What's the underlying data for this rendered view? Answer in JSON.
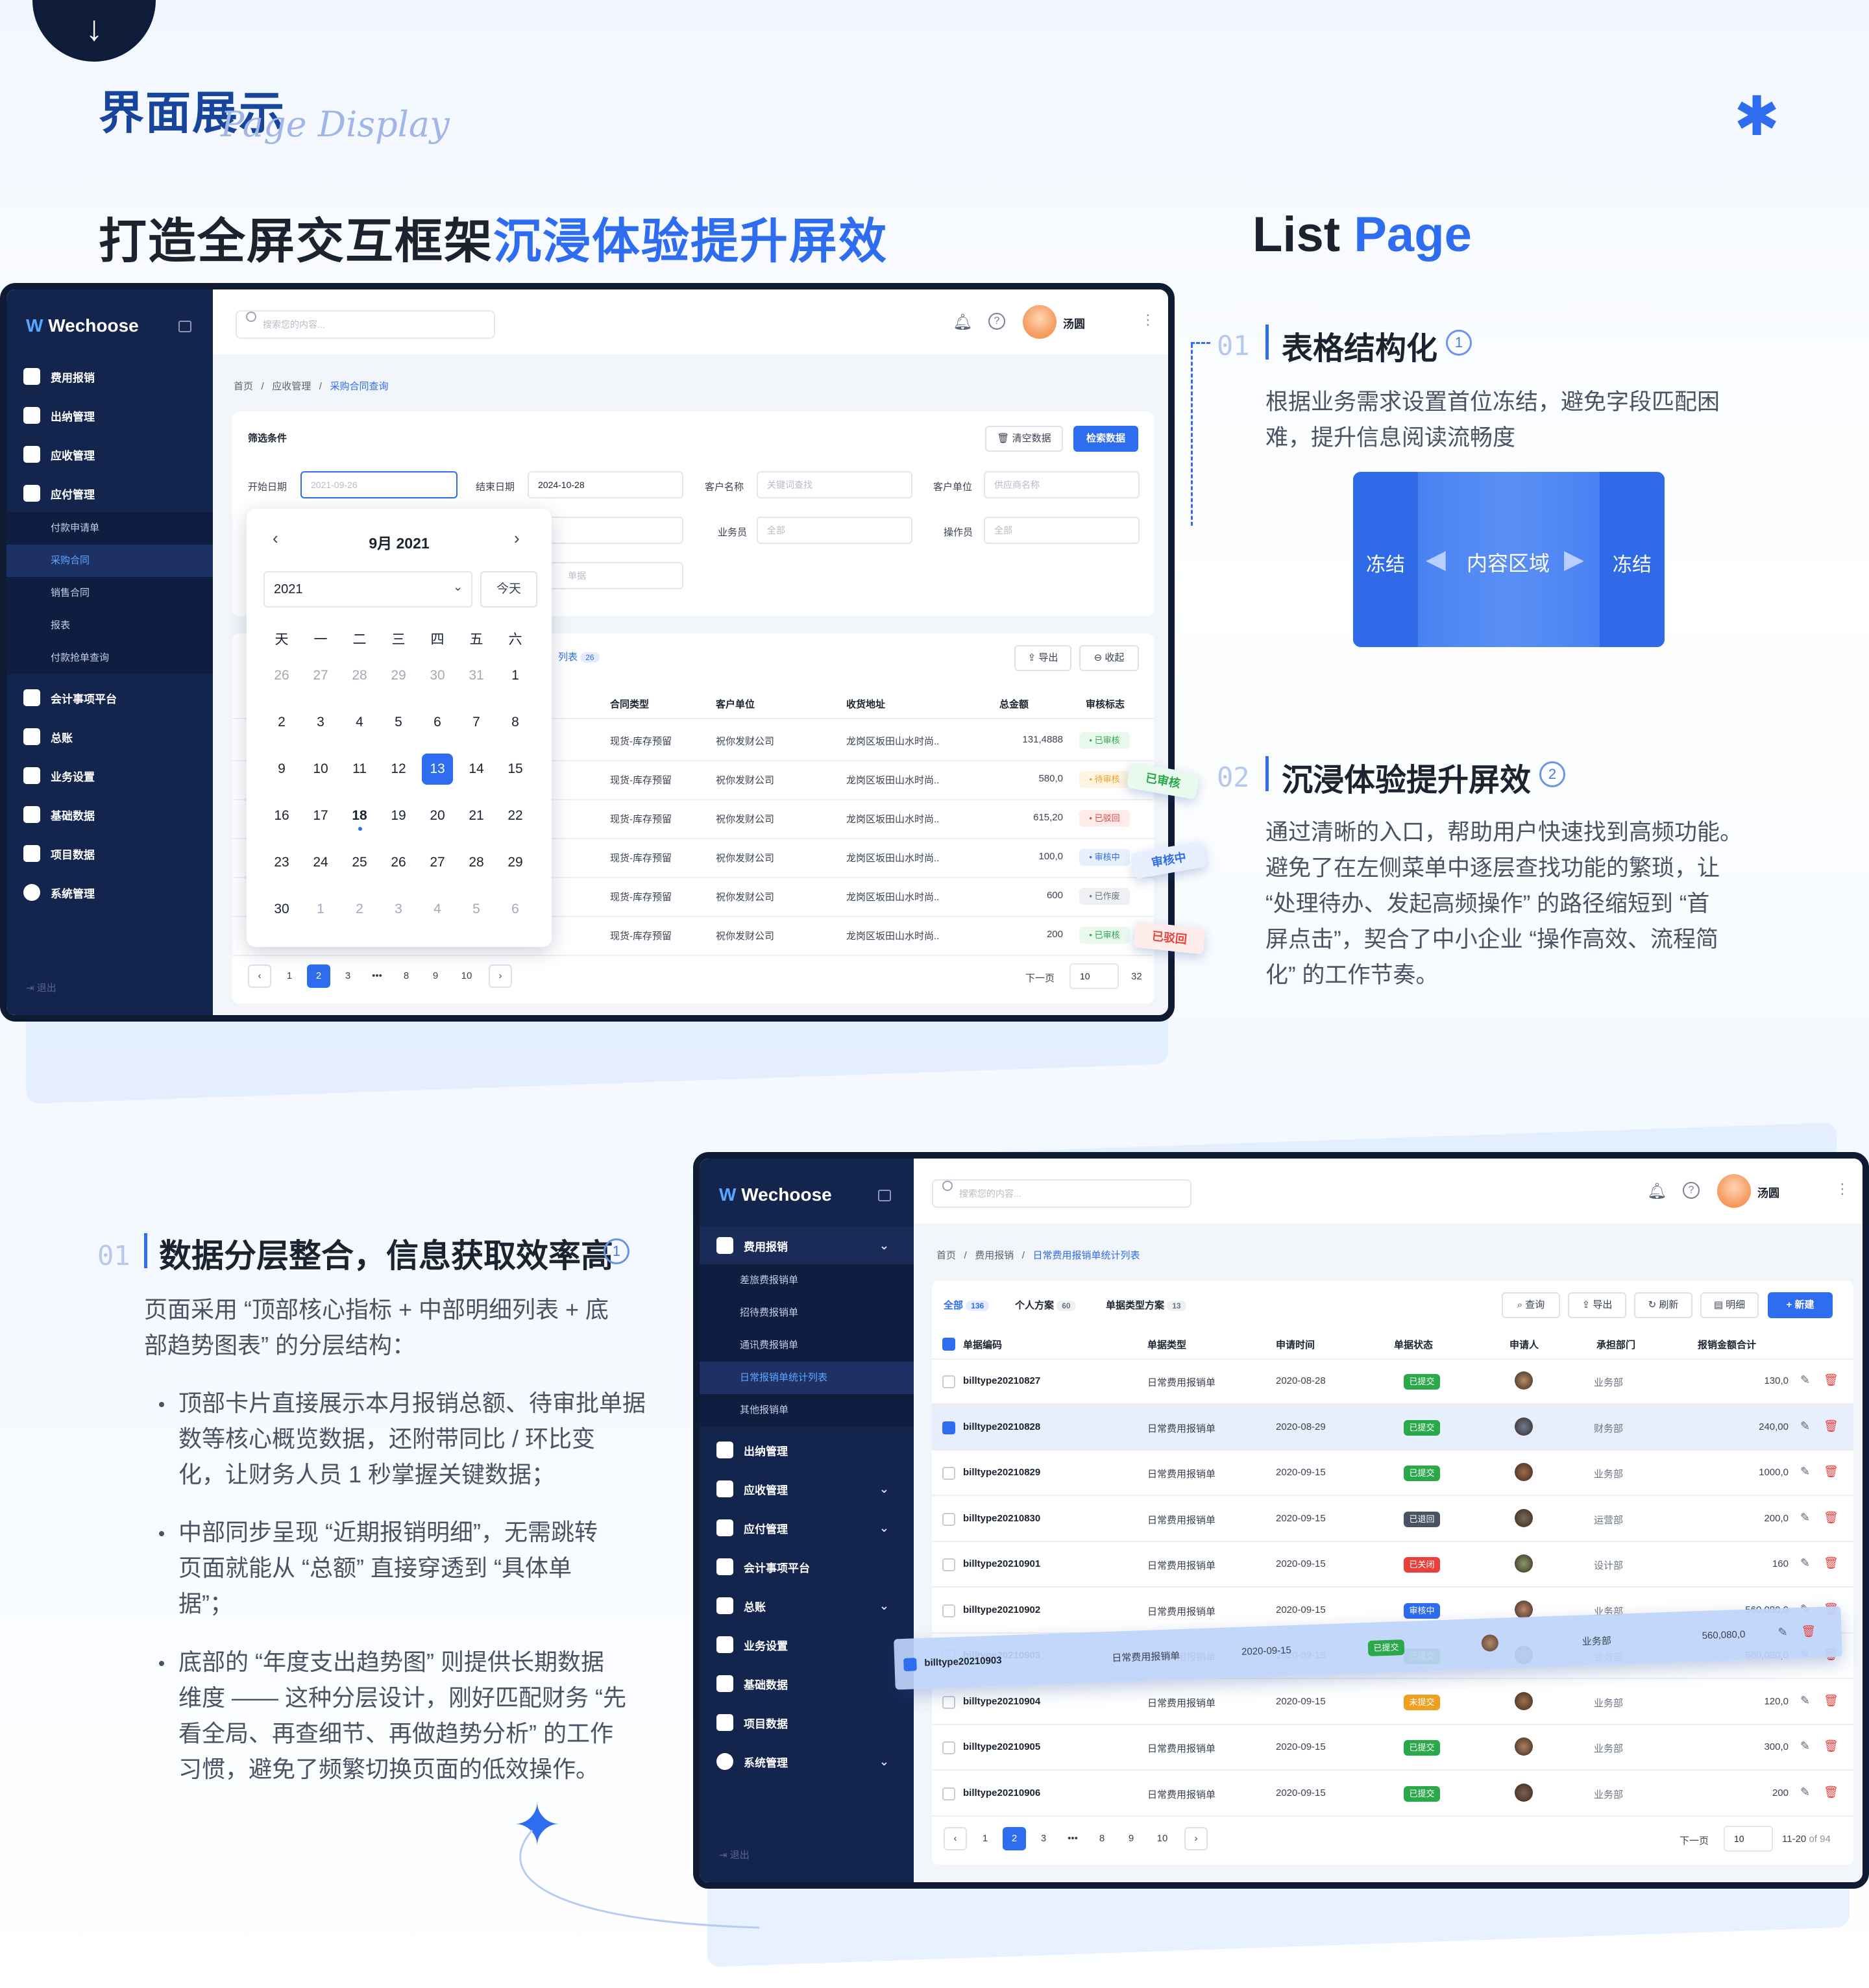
{
  "header": {
    "title": "界面展示",
    "script": "Page Display",
    "main_heading_a": "打造全屏交互框架",
    "main_heading_b": "沉浸体验提升屏效",
    "list_a": "List ",
    "list_b": "Page"
  },
  "features_right": [
    {
      "num": "01",
      "title": "表格结构化",
      "badge": "1",
      "desc": [
        "根据业务需求设置首位冻结，避免字段匹配困",
        "难，提升信息阅读流畅度"
      ]
    },
    {
      "num": "02",
      "title": "沉浸体验提升屏效",
      "badge": "2",
      "desc": [
        "通过清晰的入口，帮助用户快速找到高频功能。",
        "避免了在左侧菜单中逐层查找功能的繁琐，让",
        "“处理待办、发起高频操作” 的路径缩短到 “首",
        "屏点击”，契合了中小企业 “操作高效、流程简",
        "化” 的工作节奏。"
      ]
    }
  ],
  "freeze": {
    "left": "冻结",
    "center": "内容区域",
    "right": "冻结"
  },
  "feature_left": {
    "num": "01",
    "title": "数据分层整合，信息获取效率高",
    "badge": "1",
    "intro": [
      "页面采用 “顶部核心指标 + 中部明细列表 + 底",
      "部趋势图表” 的分层结构："
    ],
    "bullets": [
      [
        "顶部卡片直接展示本月报销总额、待审批单据",
        "数等核心概览数据，还附带同比 / 环比变",
        "化，让财务人员 1 秒掌握关键数据；"
      ],
      [
        "中部同步呈现 “近期报销明细”，无需跳转",
        "页面就能从 “总额” 直接穿透到 “具体单",
        "据”；"
      ],
      [
        "底部的 “年度支出趋势图” 则提供长期数据",
        "维度 —— 这种分层设计，刚好匹配财务 “先",
        "看全局、再查细节、再做趋势分析” 的工作",
        "习惯，避免了频繁切换页面的低效操作。"
      ]
    ]
  },
  "app": {
    "brand_a": "We",
    "brand_b": "choose",
    "search_placeholder": "搜索您的内容...",
    "user": "汤圆",
    "logout": "退出"
  },
  "s1": {
    "menu": [
      {
        "label": "费用报销",
        "chev": "⌄"
      },
      {
        "label": "出纳管理",
        "chev": ""
      },
      {
        "label": "应收管理",
        "chev": "⌄"
      },
      {
        "label": "应付管理",
        "chev": "⌄"
      }
    ],
    "sub": [
      "付款申请单",
      "采购合同",
      "销售合同",
      "报表",
      "付款抢单查询"
    ],
    "menu2": [
      {
        "label": "会计事项平台",
        "chev": ""
      },
      {
        "label": "总账",
        "chev": ""
      },
      {
        "label": "业务设置",
        "chev": ""
      },
      {
        "label": "基础数据",
        "chev": ""
      },
      {
        "label": "项目数据",
        "chev": ""
      },
      {
        "label": "系统管理",
        "chev": "⌄"
      }
    ],
    "crumb": [
      "首页",
      "/",
      "应收管理",
      "/",
      "采购合同查询"
    ],
    "filter_title": "筛选条件",
    "btn_clear": "清空数据",
    "btn_search": "检索数据",
    "labels": {
      "start": "开始日期",
      "end": "结束日期",
      "cust": "客户名称",
      "unit": "客户单位",
      "sales": "业务员",
      "oper": "操作员"
    },
    "inputs": {
      "start": "2021-09-26",
      "end": "2024-10-28",
      "cust": "关键词查找",
      "unit": "供应商名称",
      "sales": "全部",
      "oper": "全部",
      "extra": "单据"
    },
    "tab_label": "列表",
    "tab_count": "26",
    "btn_export": "导出",
    "btn_collapse": "收起",
    "cols": [
      "合同类型",
      "客户单位",
      "收货地址",
      "总金额",
      "审核标志"
    ],
    "rows": [
      [
        "现货-库存预留",
        "祝你发财公司",
        "龙岗区坂田山水时尚..",
        "131,4888",
        "已审核"
      ],
      [
        "现货-库存预留",
        "祝你发财公司",
        "龙岗区坂田山水时尚..",
        "580,0",
        "待审核"
      ],
      [
        "现货-库存预留",
        "祝你发财公司",
        "龙岗区坂田山水时尚..",
        "615,20",
        "已驳回"
      ],
      [
        "现货-库存预留",
        "祝你发财公司",
        "龙岗区坂田山水时尚..",
        "100,0",
        "审核中"
      ],
      [
        "现货-库存预留",
        "祝你发财公司",
        "龙岗区坂田山水时尚..",
        "600",
        "已作废"
      ],
      [
        "现货-库存预留",
        "祝你发财公司",
        "龙岗区坂田山水时尚..",
        "200",
        "已审核"
      ]
    ],
    "pages": [
      "1",
      "2",
      "3",
      "•••",
      "8",
      "9",
      "10"
    ],
    "next": "下一页",
    "page_size": "10",
    "total": "32",
    "float_tags": [
      "已审核",
      "审核中",
      "已驳回"
    ],
    "calendar": {
      "title": "9月 2021",
      "year": "2021",
      "today": "今天",
      "weekdays": [
        "天",
        "一",
        "二",
        "三",
        "四",
        "五",
        "六"
      ],
      "days": [
        "26",
        "27",
        "28",
        "29",
        "30",
        "31",
        "1",
        "2",
        "3",
        "4",
        "5",
        "6",
        "7",
        "8",
        "9",
        "10",
        "11",
        "12",
        "13",
        "14",
        "15",
        "16",
        "17",
        "18",
        "19",
        "20",
        "21",
        "22",
        "23",
        "24",
        "25",
        "26",
        "27",
        "28",
        "29",
        "30",
        "1",
        "2",
        "3",
        "4",
        "5",
        "6"
      ]
    }
  },
  "s2": {
    "menu": [
      {
        "label": "费用报销",
        "chev": "⌄"
      }
    ],
    "sub": [
      "差旅费报销单",
      "招待费报销单",
      "通讯费报销单",
      "日常报销单统计列表",
      "其他报销单"
    ],
    "menu2": [
      {
        "label": "出纳管理",
        "chev": ""
      },
      {
        "label": "应收管理",
        "chev": "⌄"
      },
      {
        "label": "应付管理",
        "chev": "⌄"
      },
      {
        "label": "会计事项平台",
        "chev": ""
      },
      {
        "label": "总账",
        "chev": "⌄"
      },
      {
        "label": "业务设置",
        "chev": ""
      },
      {
        "label": "基础数据",
        "chev": ""
      },
      {
        "label": "项目数据",
        "chev": ""
      },
      {
        "label": "系统管理",
        "chev": "⌄"
      }
    ],
    "crumb": [
      "首页",
      "/",
      "费用报销",
      "/",
      "日常费用报销单统计列表"
    ],
    "tabs": [
      {
        "label": "全部",
        "count": "136"
      },
      {
        "label": "个人方案",
        "count": "60"
      },
      {
        "label": "单据类型方案",
        "count": "13"
      }
    ],
    "btns": [
      "查询",
      "导出",
      "刷新",
      "明细"
    ],
    "btn_new": "+ 新建",
    "cols": [
      "单据编码",
      "单据类型",
      "申请时间",
      "单据状态",
      "申请人",
      "承担部门",
      "报销金额合计"
    ],
    "rows": [
      [
        "billtype20210827",
        "日常费用报销单",
        "2020-08-28",
        "已提交",
        "业务部",
        "130,0"
      ],
      [
        "billtype20210828",
        "日常费用报销单",
        "2020-08-29",
        "已提交",
        "财务部",
        "240,00"
      ],
      [
        "billtype20210829",
        "日常费用报销单",
        "2020-09-15",
        "已提交",
        "业务部",
        "1000,0"
      ],
      [
        "billtype20210830",
        "日常费用报销单",
        "2020-09-15",
        "已退回",
        "运营部",
        "200,0"
      ],
      [
        "billtype20210901",
        "日常费用报销单",
        "2020-09-15",
        "已关闭",
        "设计部",
        "160"
      ],
      [
        "billtype20210902",
        "日常费用报销单",
        "2020-09-15",
        "审核中",
        "业务部",
        "560,080,0"
      ],
      [
        "billtype20210903",
        "日常费用报销单",
        "2020-09-15",
        "已提交",
        "业务部",
        "560,080,0"
      ],
      [
        "billtype20210904",
        "日常费用报销单",
        "2020-09-15",
        "未提交",
        "业务部",
        "120,0"
      ],
      [
        "billtype20210905",
        "日常费用报销单",
        "2020-09-15",
        "已提交",
        "业务部",
        "300,0"
      ],
      [
        "billtype20210906",
        "日常费用报销单",
        "2020-09-15",
        "已提交",
        "业务部",
        "200"
      ]
    ],
    "pages": [
      "1",
      "2",
      "3",
      "•••",
      "8",
      "9",
      "10"
    ],
    "next": "下一页",
    "page_size": "10",
    "range": "11-20",
    "of": "of 94"
  },
  "colors": {
    "accent": "#2e6cf0",
    "navy": "#13244d",
    "green": "#2aa84a",
    "orange": "#f0a020",
    "red": "#e8403a"
  }
}
